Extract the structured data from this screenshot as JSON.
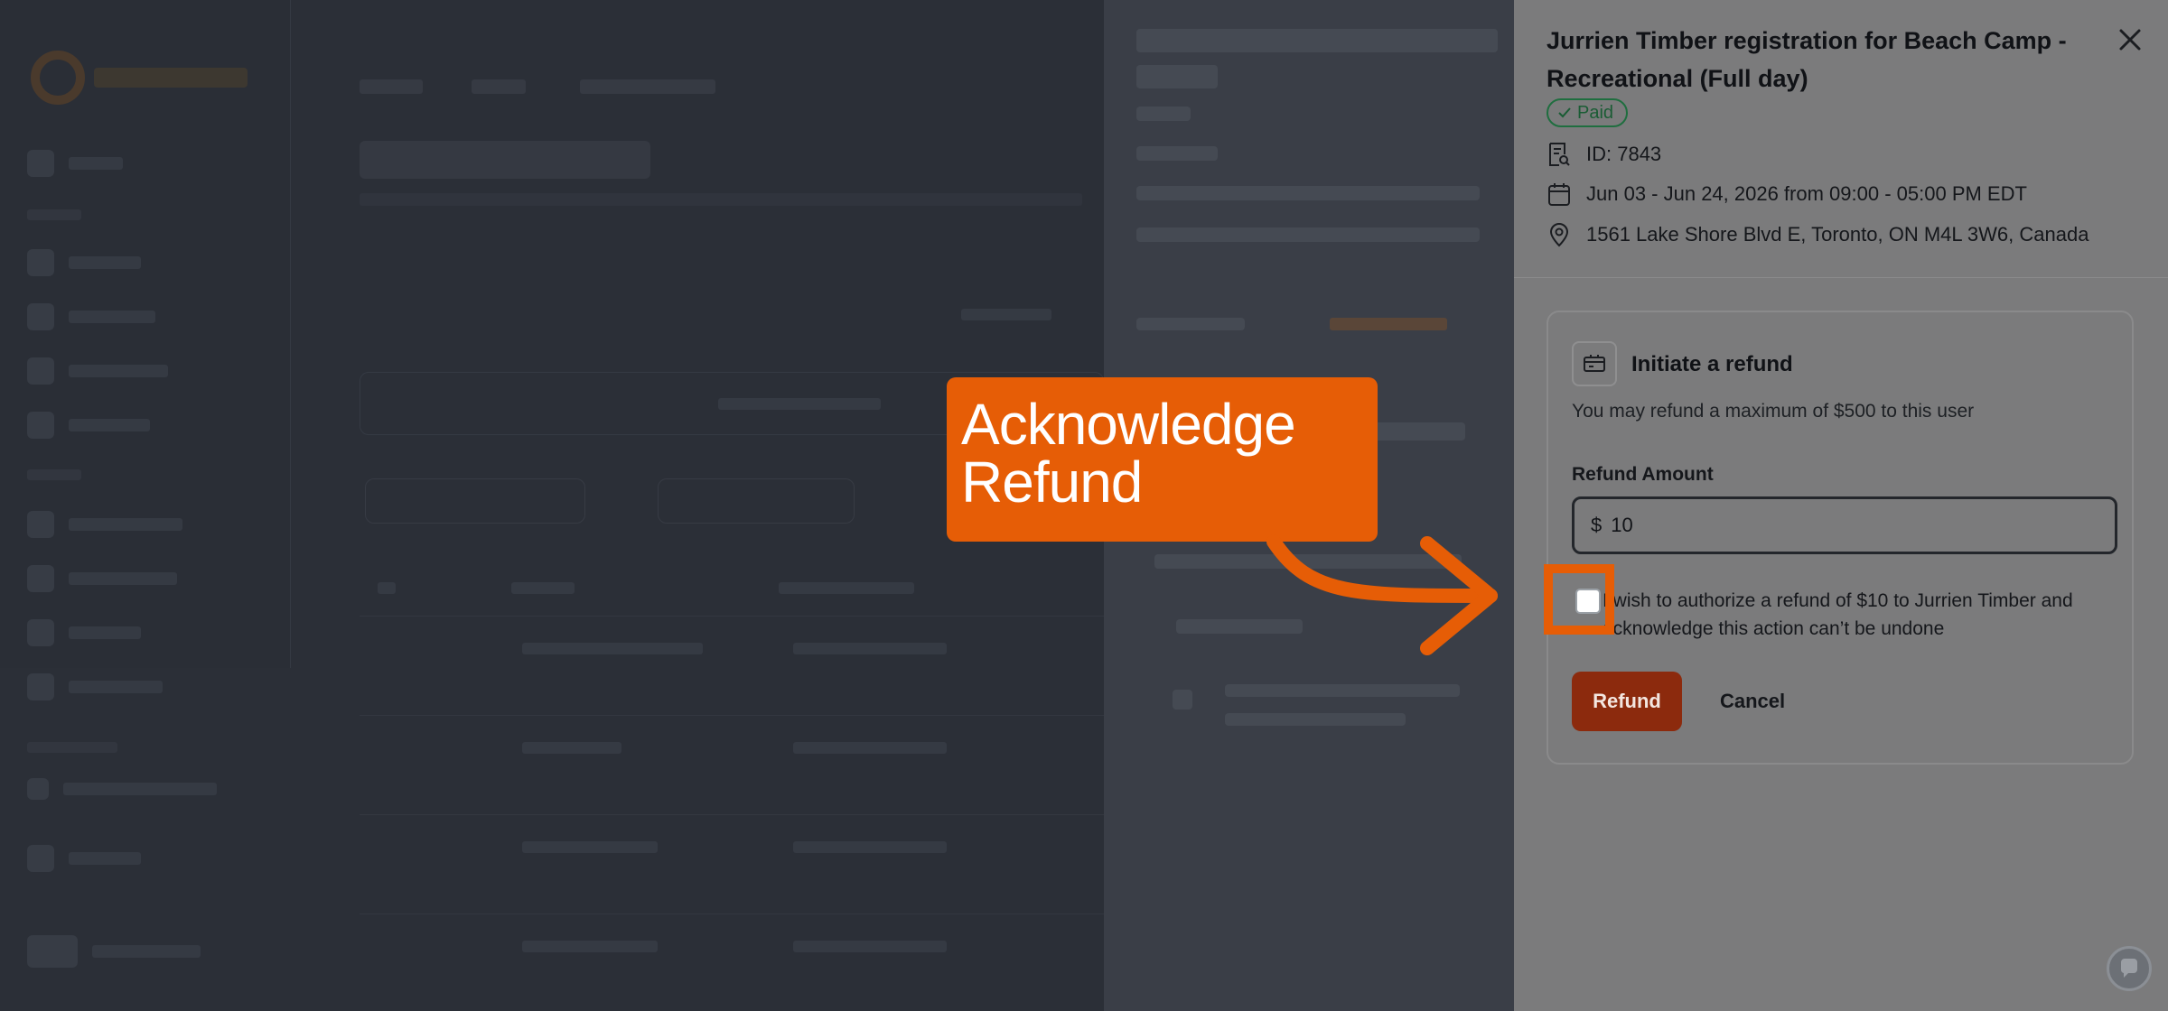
{
  "panel": {
    "title": "Jurrien Timber registration for Beach Camp - Recreational (Full day)",
    "status_badge": "Paid",
    "id_text": "ID: 7843",
    "schedule": "Jun 03 - Jun 24, 2026 from 09:00 - 05:00 PM EDT",
    "address": "1561 Lake Shore Blvd E, Toronto, ON M4L 3W6, Canada"
  },
  "refund": {
    "title": "Initiate a refund",
    "description": "You may refund a maximum of $500 to this user",
    "amount_label": "Refund Amount",
    "currency_symbol": "$",
    "amount_value": "10",
    "acknowledge_text": "I wish to authorize a refund of $10 to Jurrien Timber and acknowledge this action can’t be undone",
    "refund_button": "Refund",
    "cancel_button": "Cancel"
  },
  "callout": {
    "text": "Acknowledge Refund",
    "color": "#e65d06"
  },
  "colors": {
    "panel_bg": "#7b7b7c",
    "badge_green": "#1f6e3f",
    "refund_button": "#8c2a0d"
  },
  "icons": {
    "close": "close-icon",
    "badge_check": "check-icon",
    "id": "receipt-search-icon",
    "date": "calendar-icon",
    "location": "map-pin-icon",
    "refund": "refund-card-icon",
    "help": "help-chat-icon"
  }
}
